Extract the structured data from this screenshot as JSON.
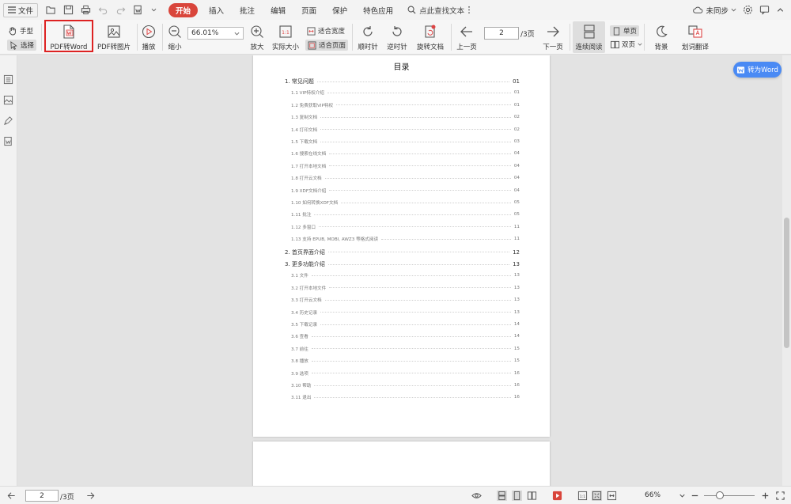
{
  "menubar": {
    "file_label": "文件",
    "tabs": [
      "开始",
      "插入",
      "批注",
      "编辑",
      "页面",
      "保护",
      "特色应用"
    ],
    "search_label": "点此查找文本",
    "sync_label": "未同步"
  },
  "ribbon": {
    "hand_label": "手型",
    "select_label": "选择",
    "pdf_to_word": "PDF转Word",
    "pdf_to_image": "PDF转图片",
    "play": "播放",
    "zoom_out": "缩小",
    "zoom_value": "66.01%",
    "zoom_in": "放大",
    "actual_size": "实际大小",
    "fit_width": "适合宽度",
    "fit_page": "适合页面",
    "rotate_cw": "顺时针",
    "rotate_ccw": "逆时针",
    "rotate_doc": "旋转文档",
    "prev_page": "上一页",
    "current_page": "2",
    "total_pages": "/3页",
    "next_page": "下一页",
    "continuous": "连续阅读",
    "single_page": "单页",
    "double_page": "双页",
    "background": "背景",
    "translate": "划词翻译"
  },
  "float_button": "转为Word",
  "toc": {
    "title": "目录",
    "rows": [
      {
        "level": 1,
        "text": "1. 常见问题",
        "page": "01"
      },
      {
        "level": 2,
        "text": "1.1 VIP特权介绍",
        "page": "01"
      },
      {
        "level": 2,
        "text": "1.2 免费获取VIP特权",
        "page": "01"
      },
      {
        "level": 2,
        "text": "1.3 复制文档",
        "page": "02"
      },
      {
        "level": 2,
        "text": "1.4 打印文档",
        "page": "02"
      },
      {
        "level": 2,
        "text": "1.5 下载文档",
        "page": "03"
      },
      {
        "level": 2,
        "text": "1.6 搜索在线文档",
        "page": "04"
      },
      {
        "level": 2,
        "text": "1.7 打开本地文档",
        "page": "04"
      },
      {
        "level": 2,
        "text": "1.8 打开云文档",
        "page": "04"
      },
      {
        "level": 2,
        "text": "1.9 XDF文档介绍",
        "page": "04"
      },
      {
        "level": 2,
        "text": "1.10 如何转换XDF文档",
        "page": "05"
      },
      {
        "level": 2,
        "text": "1.11 批注",
        "page": "05"
      },
      {
        "level": 2,
        "text": "1.12 多窗口",
        "page": "11"
      },
      {
        "level": 2,
        "text": "1.13 支持 EPUB, MOBI, AWZ3 等格式阅读",
        "page": "11"
      },
      {
        "level": 1,
        "text": "2. 首页界面介绍",
        "page": "12"
      },
      {
        "level": 1,
        "text": "3. 更多功能介绍",
        "page": "13"
      },
      {
        "level": 2,
        "text": "3.1 文件",
        "page": "13"
      },
      {
        "level": 2,
        "text": "3.2 打开本地文件",
        "page": "13"
      },
      {
        "level": 2,
        "text": "3.3 打开云文档",
        "page": "13"
      },
      {
        "level": 2,
        "text": "3.4 历史记录",
        "page": "13"
      },
      {
        "level": 2,
        "text": "3.5 下载记录",
        "page": "14"
      },
      {
        "level": 2,
        "text": "3.6 查看",
        "page": "14"
      },
      {
        "level": 2,
        "text": "3.7 前往",
        "page": "15"
      },
      {
        "level": 2,
        "text": "3.8 播放",
        "page": "15"
      },
      {
        "level": 2,
        "text": "3.9 选项",
        "page": "16"
      },
      {
        "level": 2,
        "text": "3.10 帮助",
        "page": "16"
      },
      {
        "level": 2,
        "text": "3.11 退出",
        "page": "16"
      }
    ]
  },
  "statusbar": {
    "current_page": "2",
    "total_pages": "/3页",
    "zoom": "66%"
  },
  "colors": {
    "active_tab": "#d9453b",
    "highlight": "#dd2222",
    "float_button": "#4a8af4"
  }
}
